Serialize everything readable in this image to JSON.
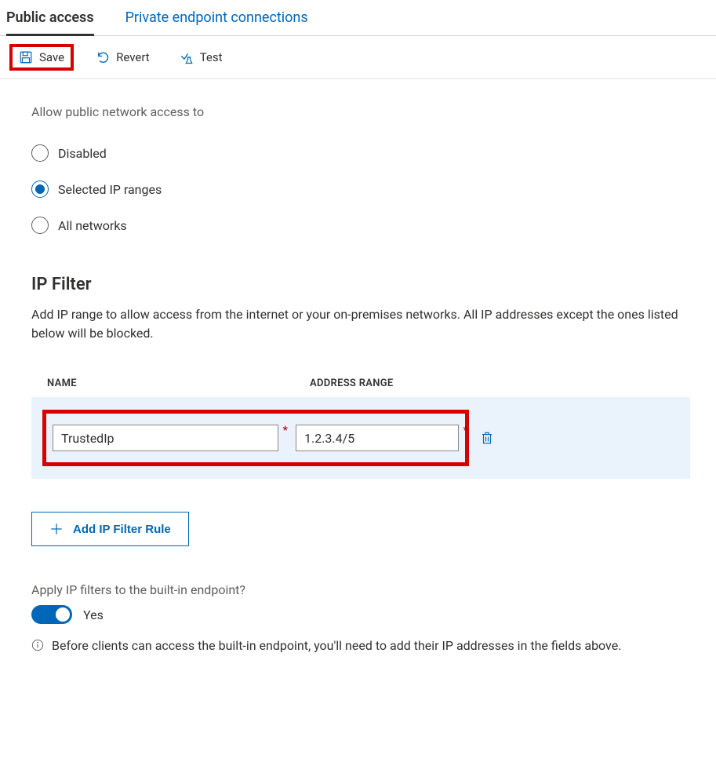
{
  "tabs": {
    "public": "Public access",
    "private": "Private endpoint connections"
  },
  "toolbar": {
    "save": "Save",
    "revert": "Revert",
    "test": "Test"
  },
  "access": {
    "label": "Allow public network access to",
    "options": {
      "disabled": "Disabled",
      "selected": "Selected IP ranges",
      "all": "All networks"
    }
  },
  "ipfilter": {
    "heading": "IP Filter",
    "description": "Add IP range to allow access from the internet or your on-premises networks. All IP addresses except the ones listed below will be blocked.",
    "columns": {
      "name": "NAME",
      "address": "ADDRESS RANGE"
    },
    "rows": [
      {
        "name": "TrustedIp",
        "address": "1.2.3.4/5"
      }
    ],
    "add_button": "Add IP Filter Rule"
  },
  "builtin": {
    "label": "Apply IP filters to the built-in endpoint?",
    "toggle_value": "Yes",
    "info": "Before clients can access the built-in endpoint, you'll need to add their IP addresses in the fields above."
  }
}
